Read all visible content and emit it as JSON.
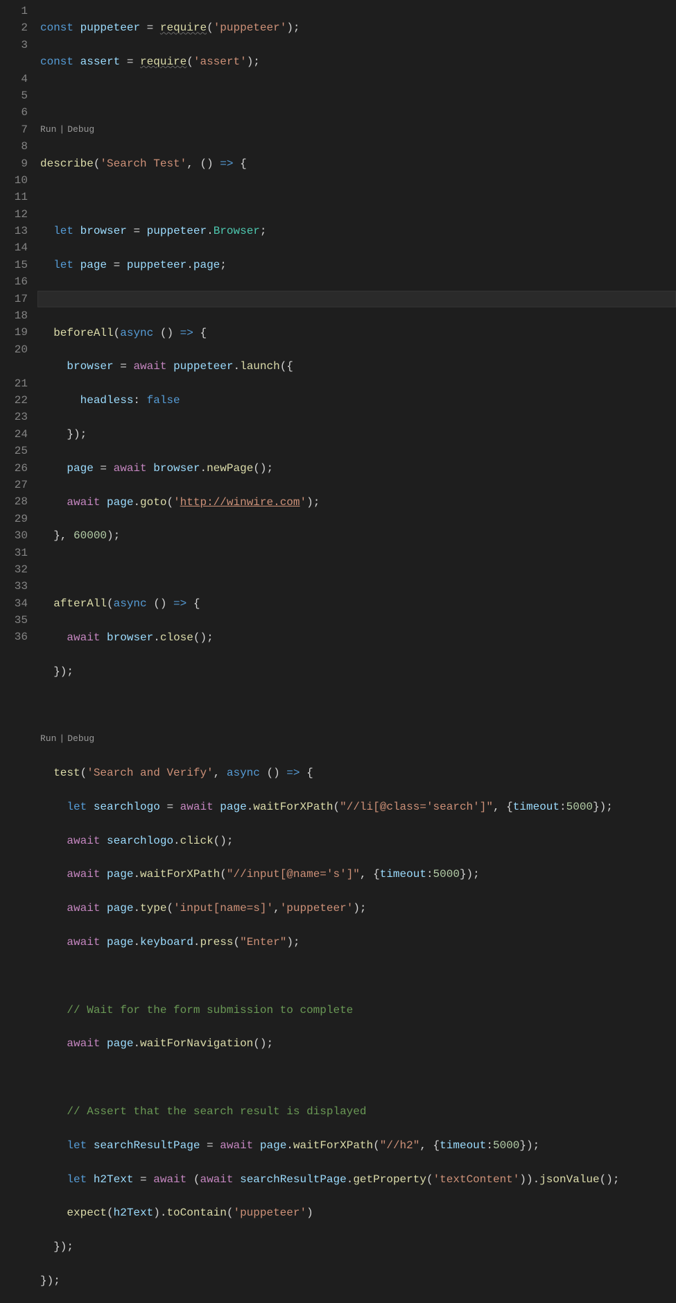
{
  "gutter": {
    "lines": [
      "1",
      "2",
      "3",
      "",
      "4",
      "5",
      "6",
      "7",
      "8",
      "9",
      "10",
      "11",
      "12",
      "13",
      "14",
      "15",
      "16",
      "17",
      "18",
      "19",
      "20",
      "",
      "21",
      "22",
      "23",
      "24",
      "25",
      "26",
      "27",
      "28",
      "29",
      "30",
      "31",
      "32",
      "33",
      "34",
      "35",
      "36"
    ]
  },
  "codelens": {
    "run": "Run",
    "debug": "Debug",
    "sep": "|"
  },
  "code": {
    "l1": {
      "const": "const",
      "p": "puppeteer",
      "eq": " = ",
      "req": "require",
      "op": "(",
      "squig": "'puppeteer'",
      "cl": ");"
    },
    "l2": {
      "const": "const",
      "a": "assert",
      "eq": " = ",
      "req": "require",
      "op": "(",
      "squig": "'assert'",
      "cl": ");"
    },
    "l4": {
      "desc": "describe",
      "op": "(",
      "str": "'Search Test'",
      "comma": ", () ",
      "arrow": "=>",
      "brace": " {"
    },
    "l6": {
      "let": "let",
      "v": "browser",
      "eq": " = ",
      "p": "puppeteer",
      "dot": ".",
      "t": "Browser",
      "end": ";"
    },
    "l7": {
      "let": "let",
      "v": "page",
      "eq": " = ",
      "p": "puppeteer",
      "dot": ".",
      "m": "page",
      "end": ";"
    },
    "l9": {
      "fn": "beforeAll",
      "op": "(",
      "async": "async",
      "paren": " () ",
      "arrow": "=>",
      "brace": " {"
    },
    "l10": {
      "v": "browser",
      "eq": " = ",
      "await": "await",
      "sp": " ",
      "p": "puppeteer",
      "dot": ".",
      "fn": "launch",
      "op": "({"
    },
    "l11": {
      "k": "headless",
      "col": ": ",
      "val": "false"
    },
    "l12": {
      "cl": "});"
    },
    "l13": {
      "v": "page",
      "eq": " = ",
      "await": "await",
      "sp": " ",
      "b": "browser",
      "dot": ".",
      "fn": "newPage",
      "paren": "();"
    },
    "l14": {
      "await": "await",
      "sp": " ",
      "v": "page",
      "dot": ".",
      "fn": "goto",
      "op": "(",
      "q": "'",
      "url": "http://winwire.com",
      "q2": "'",
      "cl": ");"
    },
    "l15": {
      "close": "}, ",
      "num": "60000",
      "end": ");"
    },
    "l17": {
      "fn": "afterAll",
      "op": "(",
      "async": "async",
      "paren": " () ",
      "arrow": "=>",
      "brace": " {"
    },
    "l18": {
      "await": "await",
      "sp": " ",
      "b": "browser",
      "dot": ".",
      "fn": "close",
      "paren": "();"
    },
    "l19": {
      "cl": "});"
    },
    "l21": {
      "fn": "test",
      "op": "(",
      "str": "'Search and Verify'",
      "comma": ", ",
      "async": "async",
      "paren": " () ",
      "arrow": "=>",
      "brace": " {"
    },
    "l22": {
      "let": "let",
      "v": "searchlogo",
      "eq": " = ",
      "await": "await",
      "sp": " ",
      "pg": "page",
      "dot": ".",
      "fn": "waitForXPath",
      "op": "(",
      "str": "\"//li[@class='search']\"",
      "comma": ", {",
      "k": "timeout",
      "col": ":",
      "num": "5000",
      "end": "});"
    },
    "l23": {
      "await": "await",
      "sp": " ",
      "v": "searchlogo",
      "dot": ".",
      "fn": "click",
      "paren": "();"
    },
    "l24": {
      "await": "await",
      "sp": " ",
      "pg": "page",
      "dot": ".",
      "fn": "waitForXPath",
      "op": "(",
      "str": "\"//input[@name='s']\"",
      "comma": ", {",
      "k": "timeout",
      "col": ":",
      "num": "5000",
      "end": "});"
    },
    "l25": {
      "await": "await",
      "sp": " ",
      "pg": "page",
      "dot": ".",
      "fn": "type",
      "op": "(",
      "s1": "'input[name=s]'",
      "comma": ",",
      "s2": "'puppeteer'",
      "end": ");"
    },
    "l26": {
      "await": "await",
      "sp": " ",
      "pg": "page",
      "dot": ".",
      "k": "keyboard",
      "dot2": ".",
      "fn": "press",
      "op": "(",
      "str": "\"Enter\"",
      "end": ");"
    },
    "l28": {
      "c": "// Wait for the form submission to complete"
    },
    "l29": {
      "await": "await",
      "sp": " ",
      "pg": "page",
      "dot": ".",
      "fn": "waitForNavigation",
      "paren": "();"
    },
    "l31": {
      "c": "// Assert that the search result is displayed"
    },
    "l32": {
      "let": "let",
      "v": "searchResultPage",
      "eq": " = ",
      "await": "await",
      "sp": " ",
      "pg": "page",
      "dot": ".",
      "fn": "waitForXPath",
      "op": "(",
      "str": "\"//h2\"",
      "comma": ", {",
      "k": "timeout",
      "col": ":",
      "num": "5000",
      "end": "});"
    },
    "l33": {
      "let": "let",
      "v": "h2Text",
      "eq": " = ",
      "await": "await",
      "sp": " (",
      "await2": "await",
      "sp2": " ",
      "srp": "searchResultPage",
      "dot": ".",
      "fn": "getProperty",
      "op": "(",
      "str": "'textContent'",
      "cp": ")).",
      "fn2": "jsonValue",
      "end": "();"
    },
    "l34": {
      "fn": "expect",
      "op": "(",
      "v": "h2Text",
      "cp": ").",
      "fn2": "toContain",
      "op2": "(",
      "str": "'puppeteer'",
      "end": ")"
    },
    "l35": {
      "cl": "});"
    },
    "l36": {
      "cl": "});"
    }
  }
}
